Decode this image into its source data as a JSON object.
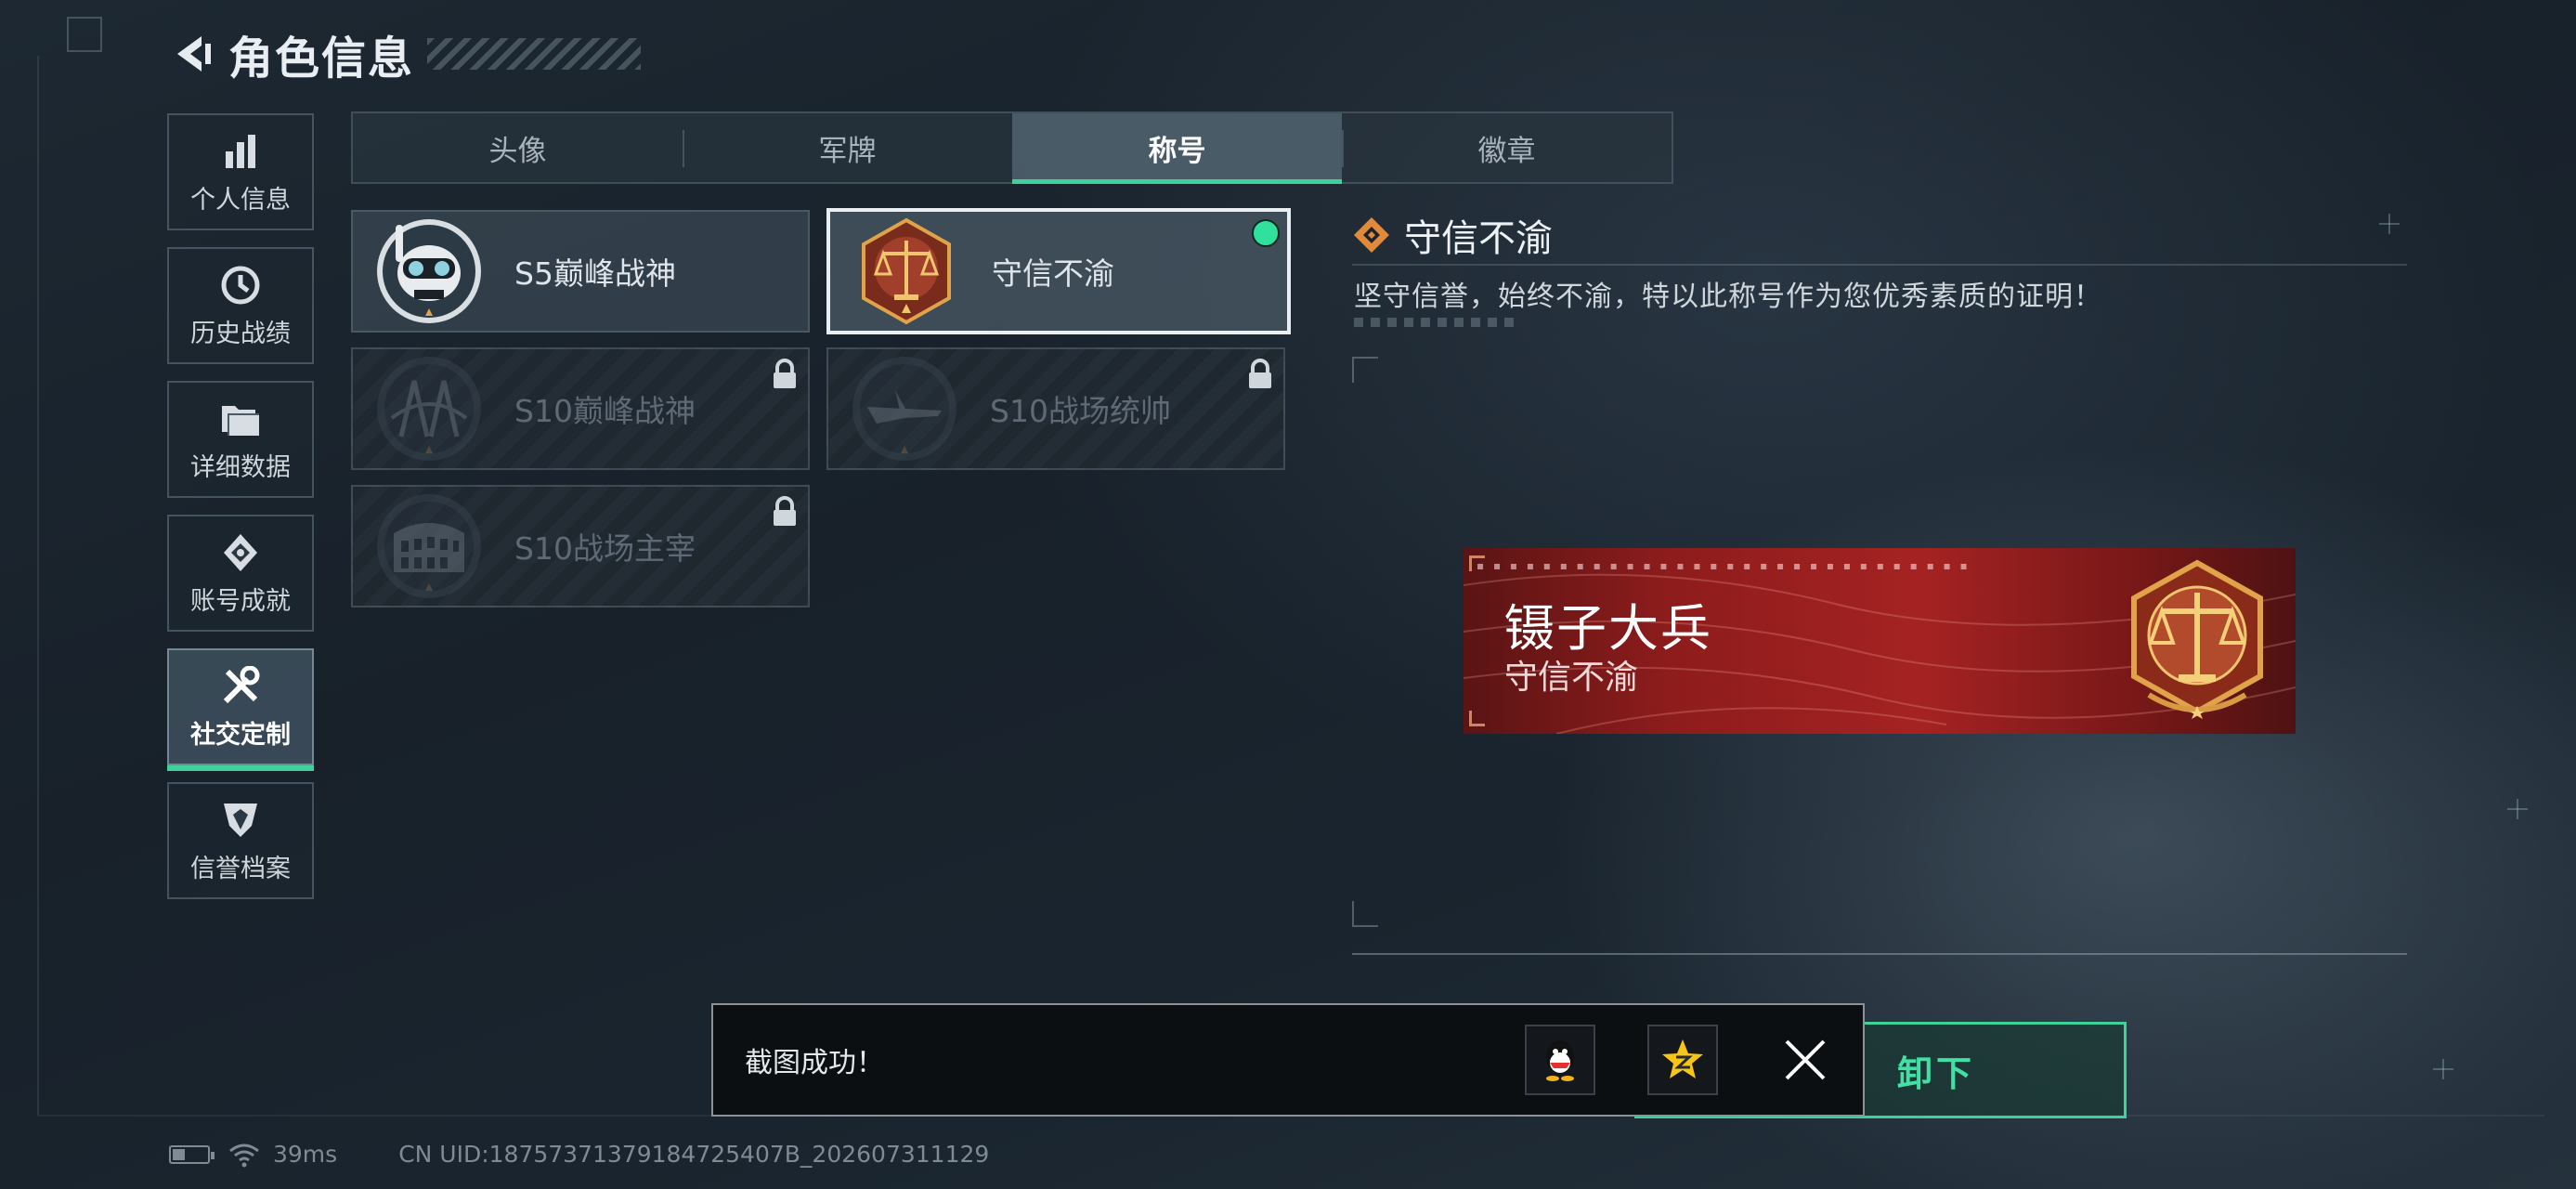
{
  "header": {
    "title": "角色信息"
  },
  "sidebar": {
    "items": [
      {
        "label": "个人信息",
        "icon": "bar-chart-icon",
        "active": false
      },
      {
        "label": "历史战绩",
        "icon": "clock-icon",
        "active": false
      },
      {
        "label": "详细数据",
        "icon": "folder-icon",
        "active": false
      },
      {
        "label": "账号成就",
        "icon": "achievement-icon",
        "active": false
      },
      {
        "label": "社交定制",
        "icon": "tools-icon",
        "active": true
      },
      {
        "label": "信誉档案",
        "icon": "shield-icon",
        "active": false
      }
    ]
  },
  "tabs": [
    {
      "label": "头像",
      "active": false
    },
    {
      "label": "军牌",
      "active": false
    },
    {
      "label": "称号",
      "active": true
    },
    {
      "label": "徽章",
      "active": false
    }
  ],
  "titles": [
    {
      "name": "S5巅峰战神",
      "emblem": "diver-skull-emblem",
      "locked": false,
      "selected": false
    },
    {
      "name": "守信不渝",
      "emblem": "scales-emblem",
      "locked": false,
      "selected": true
    },
    {
      "name": "S10巅峰战神",
      "emblem": "bridge-emblem",
      "locked": true,
      "selected": false
    },
    {
      "name": "S10战场统帅",
      "emblem": "aircraft-emblem",
      "locked": true,
      "selected": false
    },
    {
      "name": "S10战场主宰",
      "emblem": "colosseum-emblem",
      "locked": true,
      "selected": false
    }
  ],
  "detail": {
    "name": "守信不渝",
    "description": "坚守信誉，始终不渝，特以此称号作为您优秀素质的证明！"
  },
  "preview": {
    "player_name": "镊子大兵",
    "title": "守信不渝"
  },
  "unequip_button": {
    "label": "卸下"
  },
  "toast": {
    "message": "截图成功！",
    "share_icons": [
      "qq-icon",
      "qzone-icon"
    ]
  },
  "status_bar": {
    "ping": "39ms",
    "battery_level": 0.35,
    "uid": "CN UID:18757371379184725407B_202607311129"
  },
  "colors": {
    "accent": "#3fd19a",
    "selected_dot": "#2fe19c",
    "banner_red": "#a52222",
    "emblem_gold": "#e0a34a"
  }
}
